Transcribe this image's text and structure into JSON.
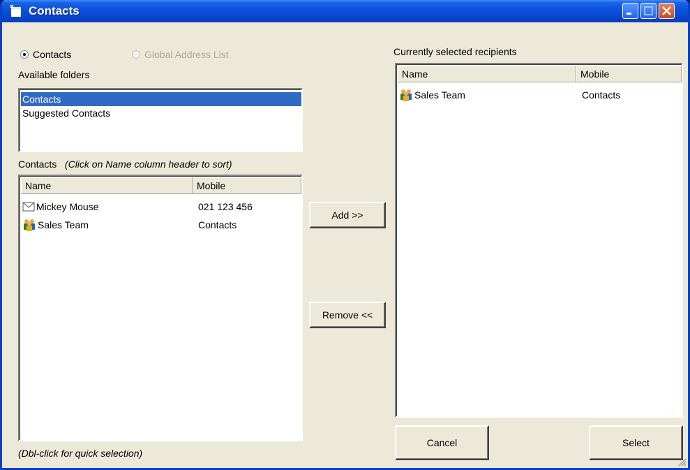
{
  "window": {
    "title": "Contacts"
  },
  "source": {
    "options": [
      {
        "label": "Contacts",
        "checked": true,
        "enabled": true
      },
      {
        "label": "Global Address List",
        "checked": false,
        "enabled": false
      }
    ]
  },
  "folders": {
    "label": "Available folders",
    "items": [
      "Contacts",
      "Suggested Contacts"
    ],
    "selected": "Contacts"
  },
  "contacts": {
    "label": "Contacts",
    "hint": "(Click on Name column header to sort)",
    "columns": [
      "Name",
      "Mobile"
    ],
    "rows": [
      {
        "name": "Mickey Mouse",
        "mobile": "021 123 456",
        "icon": "envelope-icon"
      },
      {
        "name": "Sales Team",
        "mobile": "Contacts",
        "icon": "group-icon"
      }
    ],
    "footer": "(Dbl-click for quick selection)"
  },
  "actions": {
    "add": "Add  >>",
    "remove": "Remove <<"
  },
  "recipients": {
    "label": "Currently selected recipients",
    "columns": [
      "Name",
      "Mobile"
    ],
    "rows": [
      {
        "name": "Sales Team",
        "mobile": "Contacts",
        "icon": "group-icon"
      }
    ]
  },
  "buttons": {
    "cancel": "Cancel",
    "select": "Select"
  },
  "colors": {
    "titlebar": "#0A52DB",
    "selection": "#316AC5",
    "face": "#ECE9D8"
  }
}
